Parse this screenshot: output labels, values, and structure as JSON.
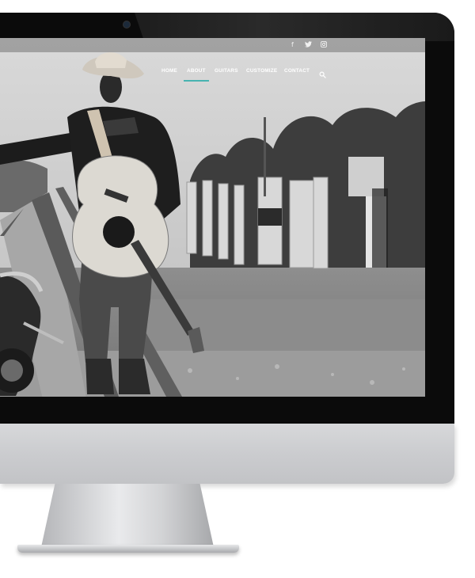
{
  "social": {
    "facebook_glyph": "f",
    "twitter_icon": "twitter-icon",
    "instagram_icon": "instagram-icon"
  },
  "nav": {
    "items": [
      {
        "label": "HOME"
      },
      {
        "label": "ABOUT",
        "active": true
      },
      {
        "label": "GUITARS"
      },
      {
        "label": "CUSTOMIZE"
      },
      {
        "label": "CONTACT"
      }
    ],
    "search_icon": "search-icon",
    "active_underline_color": "#48b3b0"
  }
}
